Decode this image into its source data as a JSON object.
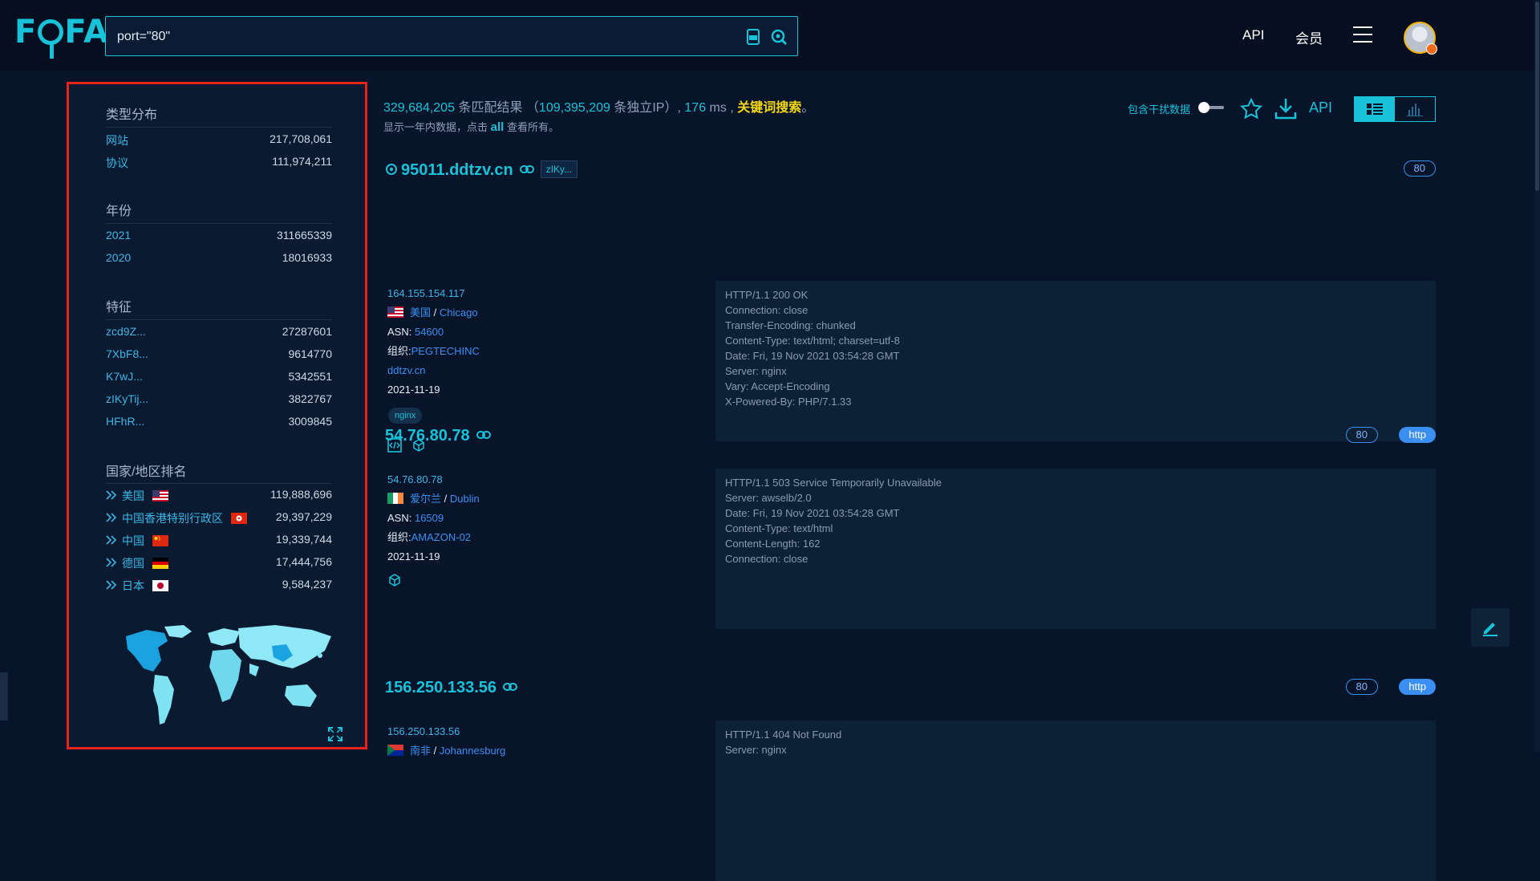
{
  "header": {
    "logo": "FOFA",
    "query": "port=\"80\"",
    "links": [
      "API",
      "会员"
    ]
  },
  "sidebar": {
    "type_title": "类型分布",
    "types": [
      {
        "label": "网站",
        "value": "217,708,061"
      },
      {
        "label": "协议",
        "value": "111,974,211"
      }
    ],
    "year_title": "年份",
    "years": [
      {
        "label": "2021",
        "value": "311665339"
      },
      {
        "label": "2020",
        "value": "18016933"
      }
    ],
    "feature_title": "特征",
    "features": [
      {
        "label": "zcd9Z...",
        "value": "27287601"
      },
      {
        "label": "7XbF8...",
        "value": "9614770"
      },
      {
        "label": "K7wJ...",
        "value": "5342551"
      },
      {
        "label": "zIKyTij...",
        "value": "3822767"
      },
      {
        "label": "HFhR...",
        "value": "3009845"
      }
    ],
    "country_title": "国家/地区排名",
    "countries": [
      {
        "label": "美国",
        "flag": "us-flag-icon",
        "value": "119,888,696"
      },
      {
        "label": "中国香港特别行政区",
        "flag": "hk-flag-icon",
        "value": "29,397,229"
      },
      {
        "label": "中国",
        "flag": "cn-flag-icon",
        "value": "19,339,744"
      },
      {
        "label": "德国",
        "flag": "de-flag-icon",
        "value": "17,444,756"
      },
      {
        "label": "日本",
        "flag": "jp-flag-icon",
        "value": "9,584,237"
      }
    ]
  },
  "summary": {
    "total": "329,684,205",
    "total_suffix": "条匹配结果",
    "paren_open": "（",
    "ips": "109,395,209",
    "ips_suffix": "条独立IP）,",
    "ms": "176",
    "ms_suffix": "ms ,",
    "keyword": "关键词搜索",
    "end": "。",
    "sub_pre": "显示一年内数据，点击",
    "sub_all": "all",
    "sub_post": "查看所有。",
    "toggle_label": "包含干扰数据",
    "api_label": "API"
  },
  "results": [
    {
      "host": "95011.ddtzv.cn",
      "tag": "zIKy...",
      "port": "80",
      "ip": "164.155.154.117",
      "country": "美国",
      "city": "Chicago",
      "asn_label": "ASN:",
      "asn": "54600",
      "org_label": "组织:",
      "org": "PEGTECHINC",
      "domain": "ddtzv.cn",
      "date": "2021-11-19",
      "server_chip": "nginx",
      "banner": "HTTP/1.1 200 OK\nConnection: close\nTransfer-Encoding: chunked\nContent-Type: text/html; charset=utf-8\nDate: Fri, 19 Nov 2021 03:54:28 GMT\nServer: nginx\nVary: Accept-Encoding\nX-Powered-By: PHP/7.1.33"
    },
    {
      "host": "54.76.80.78",
      "port": "80",
      "protocol": "http",
      "ip": "54.76.80.78",
      "country": "爱尔兰",
      "city": "Dublin",
      "asn_label": "ASN:",
      "asn": "16509",
      "org_label": "组织:",
      "org": "AMAZON-02",
      "date": "2021-11-19",
      "banner": "HTTP/1.1 503 Service Temporarily Unavailable\nServer: awselb/2.0\nDate: Fri, 19 Nov 2021 03:54:28 GMT\nContent-Type: text/html\nContent-Length: 162\nConnection: close"
    },
    {
      "host": "156.250.133.56",
      "port": "80",
      "protocol": "http",
      "ip": "156.250.133.56",
      "country": "南非",
      "city": "Johannesburg",
      "banner": "HTTP/1.1 404 Not Found\nServer: nginx"
    }
  ]
}
